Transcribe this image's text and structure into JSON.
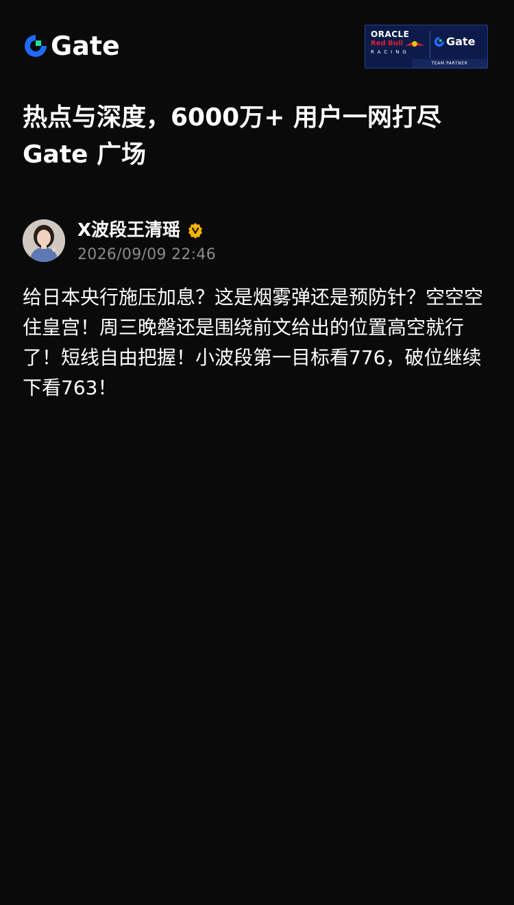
{
  "header": {
    "logo_text": "Gate",
    "partner_badge": {
      "line1": "ORACLE",
      "line2": "Red Bull",
      "line3": "RACING",
      "brand": "Gate",
      "footer": "TEAM PARTNER"
    }
  },
  "tagline": "热点与深度，6000万+ 用户一网打尽 Gate 广场",
  "post": {
    "author": "X波段王清瑶",
    "verified_icon": "verified-badge-icon",
    "timestamp": "2026/09/09 22:46",
    "body": "给日本央行施压加息？这是烟雾弹还是预防针？空空空住皇宫！周三晚磐还是围绕前文给出的位置高空就行了！短线自由把握！小波段第一目标看776，破位继续下看763！"
  },
  "colors": {
    "background": "#0a0a0a",
    "brand_blue": "#1f6bff",
    "brand_green": "#17e1a0",
    "verified": "#f5b400",
    "muted_text": "#8a8a8a"
  }
}
